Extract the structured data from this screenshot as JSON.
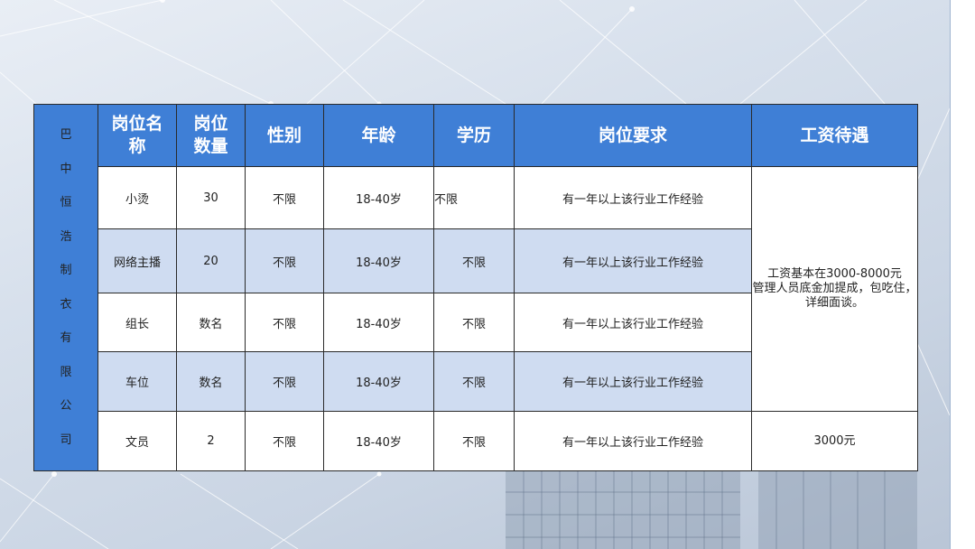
{
  "company_name_chars": [
    "巴",
    "中",
    "恒",
    "浩",
    "制",
    "衣",
    "有",
    "限",
    "公",
    "司"
  ],
  "headers": {
    "position_name": [
      "岗位名",
      "称"
    ],
    "quantity": [
      "岗位",
      "数量"
    ],
    "gender": "性别",
    "age": "年龄",
    "education": "学历",
    "requirement": "岗位要求",
    "salary": "工资待遇"
  },
  "rows": [
    {
      "position": "小烫",
      "quantity": "30",
      "gender": "不限",
      "age": "18-40岁",
      "education": "不限",
      "requirement": "有一年以上该行业工作经验"
    },
    {
      "position": "网络主播",
      "quantity": "20",
      "gender": "不限",
      "age": "18-40岁",
      "education": "不限",
      "requirement": "有一年以上该行业工作经验"
    },
    {
      "position": "组长",
      "quantity": "数名",
      "gender": "不限",
      "age": "18-40岁",
      "education": "不限",
      "requirement": "有一年以上该行业工作经验"
    },
    {
      "position": "车位",
      "quantity": "数名",
      "gender": "不限",
      "age": "18-40岁",
      "education": "不限",
      "requirement": "有一年以上该行业工作经验"
    },
    {
      "position": "文员",
      "quantity": "2",
      "gender": "不限",
      "age": "18-40岁",
      "education": "不限",
      "requirement": "有一年以上该行业工作经验"
    }
  ],
  "salary_main": [
    "工资基本在3000-8000元",
    "管理人员底金加提成，包吃住，",
    "详细面谈。"
  ],
  "salary_clerk": "3000元",
  "colors": {
    "header_blue": "#3f7fd6",
    "row_blue": "#cfdcf1"
  }
}
